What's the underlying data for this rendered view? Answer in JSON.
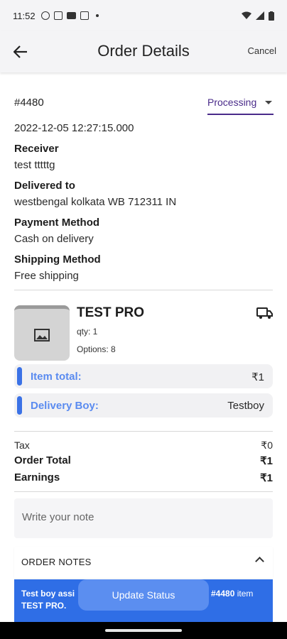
{
  "status_bar": {
    "time": "11:52"
  },
  "app_bar": {
    "title": "Order Details",
    "cancel_label": "Cancel"
  },
  "order": {
    "id": "#4480",
    "status": "Processing",
    "timestamp": "2022-12-05 12:27:15.000",
    "receiver_label": "Receiver",
    "receiver": "test tttttg",
    "delivered_to_label": "Delivered to",
    "delivered_to": "westbengal kolkata WB 712311 IN",
    "payment_label": "Payment Method",
    "payment": "Cash on delivery",
    "shipping_label": "Shipping Method",
    "shipping": "Free shipping"
  },
  "product": {
    "name": "TEST PRO",
    "qty": "qty: 1",
    "options": "Options: 8"
  },
  "pills": [
    {
      "label": "Item total:",
      "value": "₹1"
    },
    {
      "label": "Delivery Boy:",
      "value": "Testboy"
    }
  ],
  "summary": {
    "tax_label": "Tax",
    "tax": "₹0",
    "order_total_label": "Order Total",
    "order_total": "₹1",
    "earnings_label": "Earnings",
    "earnings": "₹1"
  },
  "note": {
    "placeholder": "Write your note"
  },
  "order_notes": {
    "header": "ORDER NOTES",
    "banner_left": "Test boy assi",
    "banner_right_id": "#4480",
    "banner_right_text": " item",
    "banner_line2": "TEST PRO."
  },
  "update_button": "Update Status",
  "colors": {
    "accent": "#4a2b8a",
    "blue": "#2f6ee6",
    "pill_label": "#5a8bf0"
  }
}
